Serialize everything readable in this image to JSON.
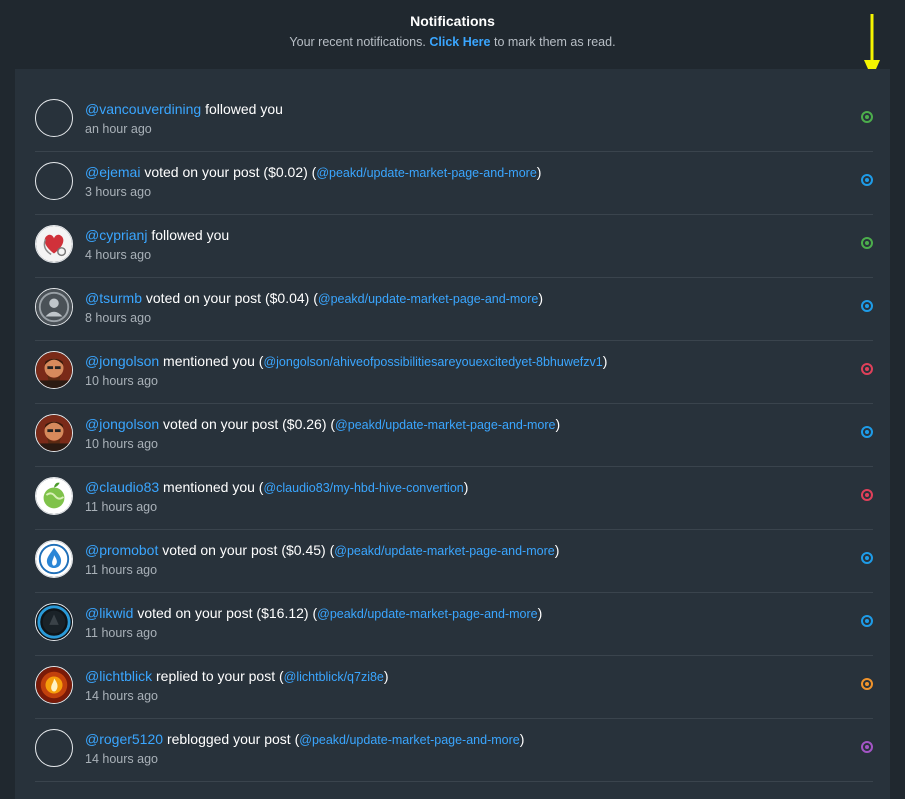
{
  "header": {
    "title": "Notifications",
    "subtitle_prefix": "Your recent notifications.",
    "click_here": "Click Here",
    "subtitle_suffix": "to mark them as read."
  },
  "notifications": [
    {
      "user": "@vancouverdining",
      "action": "followed you",
      "link": "",
      "time": "an hour ago",
      "dot_color": "#4cae4c",
      "avatar": "blank"
    },
    {
      "user": "@ejemai",
      "action": "voted on your post ($0.02)",
      "link": "@peakd/update-market-page-and-more",
      "time": "3 hours ago",
      "dot_color": "#1e9ce8",
      "avatar": "blank"
    },
    {
      "user": "@cyprianj",
      "action": "followed you",
      "link": "",
      "time": "4 hours ago",
      "dot_color": "#4cae4c",
      "avatar": "heart"
    },
    {
      "user": "@tsurmb",
      "action": "voted on your post ($0.04)",
      "link": "@peakd/update-market-page-and-more",
      "time": "8 hours ago",
      "dot_color": "#1e9ce8",
      "avatar": "person"
    },
    {
      "user": "@jongolson",
      "action": "mentioned you",
      "link": "@jongolson/ahiveofpossibilitiesareyouexcitedyet-8bhuwefzv1",
      "time": "10 hours ago",
      "dot_color": "#e0405a",
      "avatar": "face"
    },
    {
      "user": "@jongolson",
      "action": "voted on your post ($0.26)",
      "link": "@peakd/update-market-page-and-more",
      "time": "10 hours ago",
      "dot_color": "#1e9ce8",
      "avatar": "face"
    },
    {
      "user": "@claudio83",
      "action": "mentioned you",
      "link": "@claudio83/my-hbd-hive-convertion",
      "time": "11 hours ago",
      "dot_color": "#e0405a",
      "avatar": "globe"
    },
    {
      "user": "@promobot",
      "action": "voted on your post ($0.45)",
      "link": "@peakd/update-market-page-and-more",
      "time": "11 hours ago",
      "dot_color": "#1e9ce8",
      "avatar": "flame"
    },
    {
      "user": "@likwid",
      "action": "voted on your post ($16.12)",
      "link": "@peakd/update-market-page-and-more",
      "time": "11 hours ago",
      "dot_color": "#1e9ce8",
      "avatar": "ring"
    },
    {
      "user": "@lichtblick",
      "action": "replied to your post",
      "link": "@lichtblick/q7zi8e",
      "time": "14 hours ago",
      "dot_color": "#f0932b",
      "avatar": "fire"
    },
    {
      "user": "@roger5120",
      "action": "reblogged your post",
      "link": "@peakd/update-market-page-and-more",
      "time": "14 hours ago",
      "dot_color": "#a455c6",
      "avatar": "blank"
    }
  ]
}
